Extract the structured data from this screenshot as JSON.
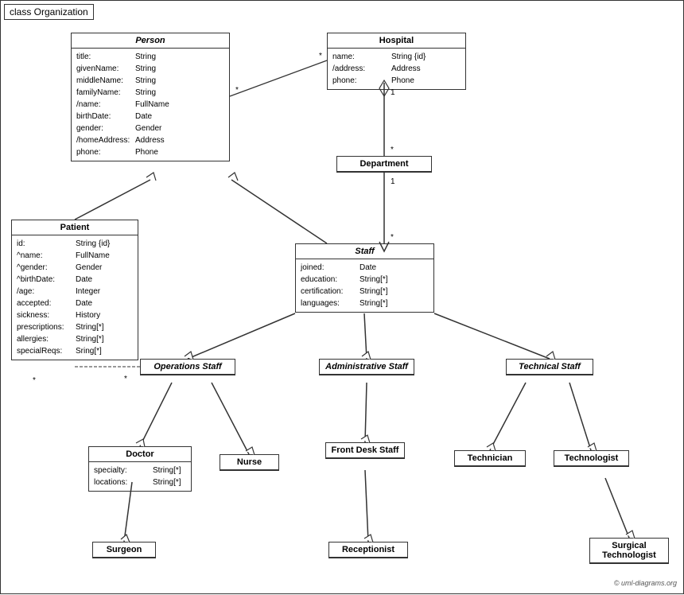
{
  "title": "class Organization",
  "copyright": "© uml-diagrams.org",
  "classes": {
    "person": {
      "name": "Person",
      "attrs": [
        {
          "name": "title:",
          "type": "String"
        },
        {
          "name": "givenName:",
          "type": "String"
        },
        {
          "name": "middleName:",
          "type": "String"
        },
        {
          "name": "familyName:",
          "type": "String"
        },
        {
          "name": "/name:",
          "type": "FullName"
        },
        {
          "name": "birthDate:",
          "type": "Date"
        },
        {
          "name": "gender:",
          "type": "Gender"
        },
        {
          "name": "/homeAddress:",
          "type": "Address"
        },
        {
          "name": "phone:",
          "type": "Phone"
        }
      ]
    },
    "hospital": {
      "name": "Hospital",
      "attrs": [
        {
          "name": "name:",
          "type": "String {id}"
        },
        {
          "name": "/address:",
          "type": "Address"
        },
        {
          "name": "phone:",
          "type": "Phone"
        }
      ]
    },
    "department": {
      "name": "Department"
    },
    "patient": {
      "name": "Patient",
      "attrs": [
        {
          "name": "id:",
          "type": "String {id}"
        },
        {
          "name": "^name:",
          "type": "FullName"
        },
        {
          "name": "^gender:",
          "type": "Gender"
        },
        {
          "name": "^birthDate:",
          "type": "Date"
        },
        {
          "name": "/age:",
          "type": "Integer"
        },
        {
          "name": "accepted:",
          "type": "Date"
        },
        {
          "name": "sickness:",
          "type": "History"
        },
        {
          "name": "prescriptions:",
          "type": "String[*]"
        },
        {
          "name": "allergies:",
          "type": "String[*]"
        },
        {
          "name": "specialReqs:",
          "type": "Sring[*]"
        }
      ]
    },
    "staff": {
      "name": "Staff",
      "attrs": [
        {
          "name": "joined:",
          "type": "Date"
        },
        {
          "name": "education:",
          "type": "String[*]"
        },
        {
          "name": "certification:",
          "type": "String[*]"
        },
        {
          "name": "languages:",
          "type": "String[*]"
        }
      ]
    },
    "operations_staff": {
      "name": "Operations Staff"
    },
    "administrative_staff": {
      "name": "Administrative Staff"
    },
    "technical_staff": {
      "name": "Technical Staff"
    },
    "doctor": {
      "name": "Doctor",
      "attrs": [
        {
          "name": "specialty:",
          "type": "String[*]"
        },
        {
          "name": "locations:",
          "type": "String[*]"
        }
      ]
    },
    "nurse": {
      "name": "Nurse"
    },
    "front_desk_staff": {
      "name": "Front Desk Staff"
    },
    "technician": {
      "name": "Technician"
    },
    "technologist": {
      "name": "Technologist"
    },
    "surgeon": {
      "name": "Surgeon"
    },
    "receptionist": {
      "name": "Receptionist"
    },
    "surgical_technologist": {
      "name": "Surgical Technologist"
    }
  }
}
